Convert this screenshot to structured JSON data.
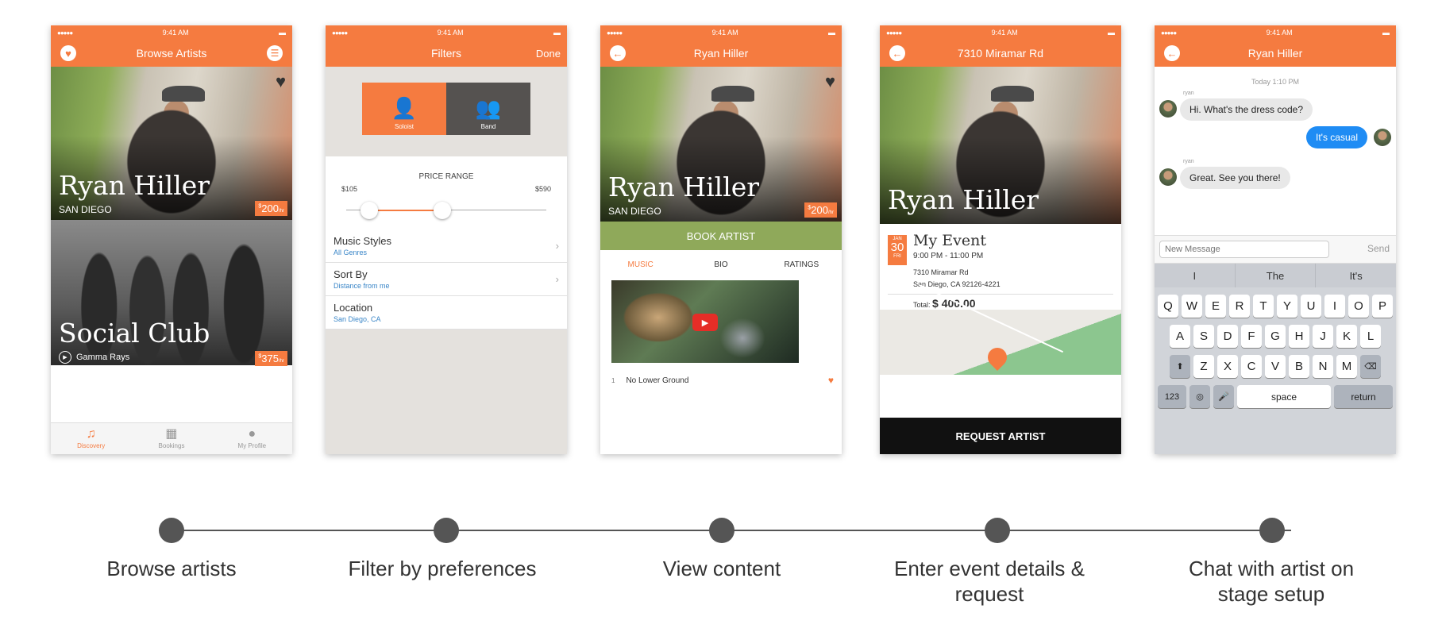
{
  "status": {
    "signal": "●●●●● ",
    "time": "9:41 AM",
    "battery": "▬"
  },
  "phone1": {
    "title": "Browse Artists",
    "left_icon": "heart-icon",
    "right_icon": "sliders-icon",
    "artist1": {
      "name": "Ryan Hiller",
      "city": "SAN DIEGO",
      "price": "200"
    },
    "artist2": {
      "name": "Social Club",
      "subtitle": "Gamma Rays",
      "price": "375"
    },
    "tabs": [
      {
        "label": "Discovery",
        "icon": "music-note-icon"
      },
      {
        "label": "Bookings",
        "icon": "calendar-icon"
      },
      {
        "label": "My Profile",
        "icon": "profile-icon"
      }
    ]
  },
  "phone2": {
    "title": "Filters",
    "done": "Done",
    "segments": [
      {
        "label": "Soloist"
      },
      {
        "label": "Band"
      }
    ],
    "price_range": {
      "title": "PRICE RANGE",
      "min": "$105",
      "max": "$590"
    },
    "rows": [
      {
        "title": "Music Styles",
        "sub": "All Genres"
      },
      {
        "title": "Sort By",
        "sub": "Distance from me"
      },
      {
        "title": "Location",
        "sub": "San Diego, CA"
      }
    ]
  },
  "phone3": {
    "title": "Ryan Hiller",
    "name": "Ryan Hiller",
    "city": "SAN DIEGO",
    "price": "200",
    "book": "BOOK ARTIST",
    "tabs": [
      "MUSIC",
      "BIO",
      "RATINGS"
    ],
    "track": {
      "num": "1",
      "title": "No Lower Ground"
    }
  },
  "phone4": {
    "title": "7310 Miramar Rd",
    "name": "Ryan Hiller",
    "date": {
      "month": "JAN",
      "day": "30",
      "weekday": "FRI"
    },
    "event_title": "My Event",
    "event_time": "9:00 PM - 11:00 PM",
    "addr1": "7310 Miramar Rd",
    "addr2": "San Diego, CA  92126-4221",
    "total_label": "Total:",
    "total": "$ 400.00",
    "request": "REQUEST ARTIST"
  },
  "phone5": {
    "title": "Ryan Hiller",
    "timestamp": "Today 1:10 PM",
    "sender": "ryan",
    "messages": [
      {
        "text": "Hi. What's the dress code?"
      },
      {
        "text": "It's casual"
      },
      {
        "text": "Great. See you there!"
      }
    ],
    "placeholder": "New Message",
    "send": "Send",
    "suggestions": [
      "I",
      "The",
      "It's"
    ],
    "keys_row1": [
      "Q",
      "W",
      "E",
      "R",
      "T",
      "Y",
      "U",
      "I",
      "O",
      "P"
    ],
    "keys_row2": [
      "A",
      "S",
      "D",
      "F",
      "G",
      "H",
      "J",
      "K",
      "L"
    ],
    "keys_row3": [
      "Z",
      "X",
      "C",
      "V",
      "B",
      "N",
      "M"
    ],
    "key_123": "123",
    "key_space": "space",
    "key_return": "return"
  },
  "timeline": [
    {
      "label": "Browse artists"
    },
    {
      "label": "Filter by preferences"
    },
    {
      "label": "View content"
    },
    {
      "label": "Enter event details & request"
    },
    {
      "label": "Chat with artist on stage setup"
    }
  ],
  "colors": {
    "accent": "#f57b40",
    "green": "#8fa95a",
    "blue": "#1f8cf4"
  }
}
